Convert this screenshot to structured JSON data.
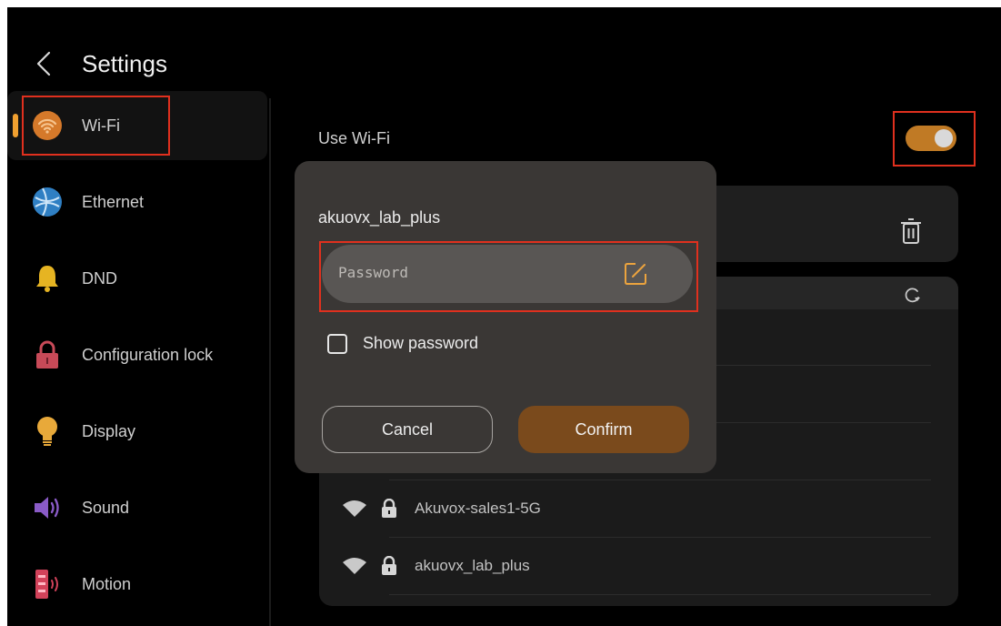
{
  "header": {
    "title": "Settings"
  },
  "sidebar": {
    "items": [
      {
        "label": "Wi-Fi",
        "icon": "wifi-icon",
        "active": true
      },
      {
        "label": "Ethernet",
        "icon": "globe-icon"
      },
      {
        "label": "DND",
        "icon": "bell-icon"
      },
      {
        "label": "Configuration lock",
        "icon": "lock-icon"
      },
      {
        "label": "Display",
        "icon": "bulb-icon"
      },
      {
        "label": "Sound",
        "icon": "speaker-icon"
      },
      {
        "label": "Motion",
        "icon": "motion-sensor-icon"
      }
    ]
  },
  "main": {
    "use_wifi_label": "Use Wi-Fi",
    "wifi_enabled": true,
    "networks": [
      {
        "name": "Akuvox-sales1-5G"
      },
      {
        "name": "akuovx_lab_plus"
      }
    ]
  },
  "dialog": {
    "title": "akuovx_lab_plus",
    "password_placeholder": "Password",
    "show_password_label": "Show password",
    "cancel_label": "Cancel",
    "confirm_label": "Confirm"
  },
  "colors": {
    "accent": "#c07a25",
    "confirm": "#7a4a1c",
    "dialog_bg": "#3a3735",
    "annotation": "#e0301e"
  }
}
